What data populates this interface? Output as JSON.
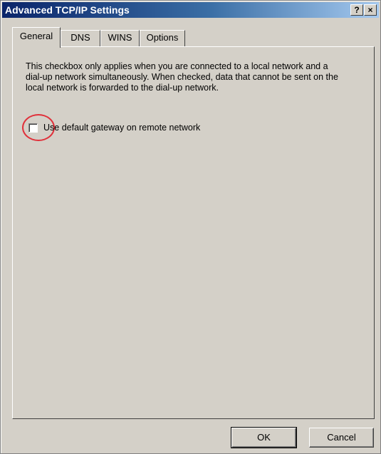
{
  "window": {
    "title": "Advanced TCP/IP Settings",
    "help_label": "?",
    "close_label": "×"
  },
  "tabs": [
    {
      "label": "General",
      "active": true
    },
    {
      "label": "DNS",
      "active": false
    },
    {
      "label": "WINS",
      "active": false
    },
    {
      "label": "Options",
      "active": false
    }
  ],
  "general": {
    "description": "This checkbox only applies when you are connected to a local network and a dial-up network simultaneously.  When checked, data that cannot be sent on the local network is forwarded to the dial-up network.",
    "checkbox_label": "Use default gateway on remote network",
    "checkbox_checked": false
  },
  "buttons": {
    "ok_label": "OK",
    "cancel_label": "Cancel"
  },
  "colors": {
    "title_gradient_start": "#0a246a",
    "title_gradient_end": "#a6caf0",
    "face": "#d4d0c8",
    "annotation_circle": "#e0303a"
  },
  "icons": {
    "help": "help-icon",
    "close": "close-icon"
  }
}
